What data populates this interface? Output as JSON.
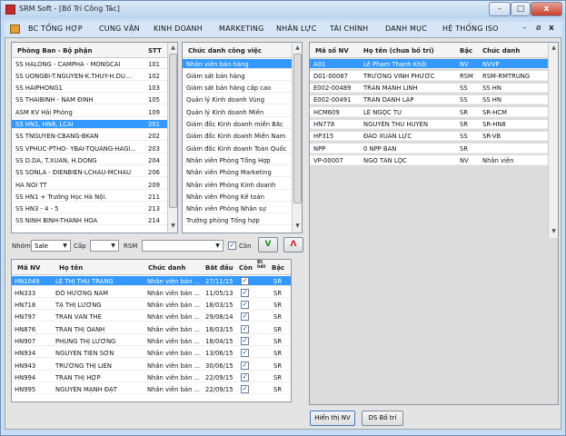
{
  "window": {
    "title": "SRM Soft - [Bố Trí Công Tác]",
    "minimize": "–",
    "maximize": "□",
    "close": "x"
  },
  "menu": {
    "items": [
      "BC TỔNG HỢP",
      "CUNG VẬN",
      "KINH DOANH",
      "MARKETING",
      "NHÂN LỰC",
      "TÀI CHÍNH",
      "DANH MỤC",
      "HỆ THỐNG ISO"
    ],
    "controls": {
      "minimize": "–",
      "restore": "ø",
      "close": "x"
    }
  },
  "phongban": {
    "headers": [
      "Phòng Ban - Bộ phận",
      "STT"
    ],
    "rows": [
      [
        "SS HALONG - CAMPHA - MONGCAI",
        "101"
      ],
      [
        "SS UONGBI-T.NGUYEN-K.THUY-H.DU...",
        "102"
      ],
      [
        "SS HAIPHONG1",
        "103"
      ],
      [
        "SS THAIBINH - NAM ĐINH",
        "105"
      ],
      [
        "ASM KV Hải Phòng",
        "109"
      ],
      [
        "SS HN1, HN8, LCAI",
        "201"
      ],
      [
        "SS TNGUYEN-CBANG-BKAN",
        "202"
      ],
      [
        "SS VPHUC-PTHO- YBAI-TQUANG-HAGI...",
        "203"
      ],
      [
        "SS D.DA, T.XUAN, H.DONG",
        "204"
      ],
      [
        "SS SONLA - ĐIENBIEN-LCHAU-MCHAU",
        "206"
      ],
      [
        "HA NOI TT",
        "209"
      ],
      [
        "SS HN1 + Trưởng Học Hà Nội.",
        "211"
      ],
      [
        "SS HN3 - 4 - 5",
        "213"
      ],
      [
        "SS NINH BINH-THANH HOA",
        "214"
      ]
    ],
    "selected_index": 5
  },
  "chucdanh": {
    "header": "Chức danh công việc",
    "rows": [
      "Nhân viên bán hàng",
      "Giám sát bán hàng",
      "Giám sát bán hàng cấp cao",
      "Quản lý Kinh doanh Vùng",
      "Quản lý Kinh doanh Miền",
      "Giám đốc Kinh doanh miền Bắc",
      "Giám đốc Kinh doanh Miền Nam",
      "Giám đốc Kinh doanh Toàn Quốc",
      "Nhân viên Phòng Tổng Hợp",
      "Nhân viên Phòng Marketing",
      "Nhân viên Phòng Kinh doanh",
      "Nhân viên Phòng Kế toán",
      "Nhân viên Phòng Nhân sự",
      "Trưởng phòng Tổng hợp"
    ],
    "selected_index": 0
  },
  "nhanvien_right": {
    "headers": [
      "Mã số NV",
      "Họ tên (chưa bố trí)",
      "Bậc",
      "Chức danh"
    ],
    "rows": [
      [
        "A01",
        "Lê Phạm Thanh Khôi",
        "NV",
        "NVVP"
      ],
      [
        "D01-00087",
        "TRƯƠNG VĨNH PHƯỚC",
        "RSM",
        "RSM-RMTRUNG"
      ],
      [
        "E002-00489",
        "TRẦN MẠNH LINH",
        "SS",
        "SS HN"
      ],
      [
        "E002-00491",
        "TRẦN DANH LẬP",
        "SS",
        "SS HN"
      ],
      [
        "HCM609",
        "LÊ NGỌC TÚ",
        "SR",
        "SR-HCM"
      ],
      [
        "HN778",
        "NGUYỄN THU HUYỀN",
        "SR",
        "SR-HN8"
      ],
      [
        "HP315",
        "ĐÀO XUÂN LỰC",
        "SS",
        "SR-VB"
      ],
      [
        "NPP",
        "0 NPP BAN",
        "SR",
        ""
      ],
      [
        "VP-00007",
        "NGÔ TẤN LỘC",
        "NV",
        "Nhân viên"
      ]
    ],
    "selected_index": 0
  },
  "filter": {
    "nhom_label": "Nhóm",
    "nhom_value": "Sale",
    "cap_label": "Cấp",
    "cap_value": "",
    "rsm_label": "RSM",
    "rsm_value": "",
    "con_label": "Còn",
    "con_checked": true,
    "accept": "V",
    "remove": "Λ"
  },
  "assigned": {
    "headers": [
      "Mã NV",
      "Họ tên",
      "Chức danh",
      "Bắt đầu",
      "Còn",
      "Đi hết",
      "Bậc"
    ],
    "rows": [
      [
        "HN1049",
        "LÊ THỊ THU TRANG",
        "Nhân viên bán ...",
        "27/11/15",
        "SR"
      ],
      [
        "HN333",
        "ĐỖ HƯƠNG NAM",
        "Nhân viên bán ...",
        "11/05/13",
        "SR"
      ],
      [
        "HN718",
        "TẠ THỊ LƯƠNG",
        "Nhân viên bán ...",
        "18/03/15",
        "SR"
      ],
      [
        "HN797",
        "TRẦN VĂN THẾ",
        "Nhân viên bán ...",
        "29/08/14",
        "SR"
      ],
      [
        "HN876",
        "TRẦN THỊ OANH",
        "Nhân viên bán ...",
        "18/03/15",
        "SR"
      ],
      [
        "HN907",
        "PHÙNG THỊ LƯƠNG",
        "Nhân viên bán ...",
        "18/04/15",
        "SR"
      ],
      [
        "HN934",
        "NGUYỄN TIẾN SƠN",
        "Nhân viên bán ...",
        "13/06/15",
        "SR"
      ],
      [
        "HN943",
        "TRƯƠNG THỊ LIÊN",
        "Nhân viên bán ...",
        "30/06/15",
        "SR"
      ],
      [
        "HN994",
        "TRẦN THỊ HỢP",
        "Nhân viên bán ...",
        "22/09/15",
        "SR"
      ],
      [
        "HN995",
        "NGUYỄN MẠNH ĐẠT",
        "Nhân viên bán ...",
        "22/09/15",
        "SR"
      ]
    ],
    "selected_index": 0
  },
  "buttons": {
    "show_nv": "Hiển thị NV",
    "ds_botri": "DS Bố trí"
  }
}
